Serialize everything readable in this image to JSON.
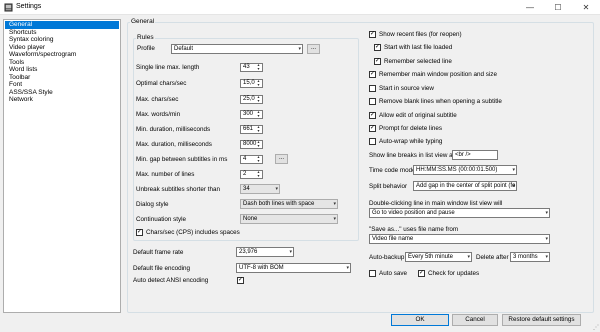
{
  "window": {
    "title": "Settings",
    "icon": "settings-app-icon",
    "minimize_glyph": "—",
    "maximize_glyph": "☐",
    "close_glyph": "✕"
  },
  "nav": {
    "items": [
      "General",
      "Shortcuts",
      "Syntax coloring",
      "Video player",
      "Waveform/spectrogram",
      "Tools",
      "Word lists",
      "Toolbar",
      "Font",
      "ASS/SSA Style",
      "Network"
    ],
    "selected": "General"
  },
  "general": {
    "group_title": "General",
    "rules": {
      "title": "Rules",
      "profile_label": "Profile",
      "profile_value": "Default",
      "profile_more": "...",
      "single_line_max_length_label": "Single line max. length",
      "single_line_max_length": "43",
      "optimal_chars_sec_label": "Optimal chars/sec",
      "optimal_chars_sec": "15,0",
      "max_chars_sec_label": "Max. chars/sec",
      "max_chars_sec": "25,0",
      "max_words_min_label": "Max. words/min",
      "max_words_min": "300",
      "min_duration_label": "Min. duration, milliseconds",
      "min_duration": "661",
      "max_duration_label": "Max. duration, milliseconds",
      "max_duration": "8000",
      "min_gap_label": "Min. gap between subtitles in ms",
      "min_gap": "4",
      "min_gap_more": "...",
      "max_lines_label": "Max. number of lines",
      "max_lines": "2",
      "unbreak_label": "Unbreak subtitles shorter than",
      "unbreak_value": "34",
      "dialog_style_label": "Dialog style",
      "dialog_style_value": "Dash both lines with space",
      "continuation_style_label": "Continuation style",
      "continuation_style_value": "None",
      "cps_spaces_label": "Chars/sec (CPS) includes spaces",
      "cps_spaces_checked": true
    },
    "default_frame_rate_label": "Default frame rate",
    "default_frame_rate": "23,976",
    "default_encoding_label": "Default file encoding",
    "default_encoding": "UTF-8 with BOM",
    "auto_detect_ansi_label": "Auto detect ANSI encoding",
    "auto_detect_ansi_checked": true,
    "right": {
      "show_recent_label": "Show recent files (for reopen)",
      "show_recent_checked": true,
      "start_last_file_label": "Start with last file loaded",
      "start_last_file_checked": true,
      "remember_selected_label": "Remember selected line",
      "remember_selected_checked": true,
      "remember_window_label": "Remember main window position and size",
      "remember_window_checked": true,
      "start_source_view_label": "Start in source view",
      "start_source_view_checked": false,
      "remove_blank_label": "Remove blank lines when opening a subtitle",
      "remove_blank_checked": false,
      "allow_edit_label": "Allow edit of original subtitle",
      "allow_edit_checked": true,
      "prompt_delete_label": "Prompt for delete lines",
      "prompt_delete_checked": true,
      "auto_wrap_label": "Auto-wrap while typing",
      "auto_wrap_checked": false,
      "line_breaks_label": "Show line breaks in list view as",
      "line_breaks_value": "<br />",
      "time_code_label": "Time code mode",
      "time_code_value": "HH:MM:SS.MS (00:00:01.500)",
      "split_behavior_label": "Split behavior",
      "split_behavior_value": "Add gap in the center of split point (fo",
      "dblclick_label": "Double-clicking line in main window list view will",
      "dblclick_value": "Go to video position and pause",
      "save_as_label": "\"Save as...\" uses file name from",
      "save_as_value": "Video file name",
      "auto_backup_label": "Auto-backup",
      "auto_backup_value": "Every 5th minute",
      "delete_after_label": "Delete after",
      "delete_after_value": "3 months",
      "auto_save_label": "Auto save",
      "auto_save_checked": false,
      "check_updates_label": "Check for updates",
      "check_updates_checked": true
    }
  },
  "footer": {
    "ok": "OK",
    "cancel": "Cancel",
    "restore": "Restore default settings"
  },
  "glyphs": {
    "check": "✓",
    "dropdown": "▾",
    "spin_up": "▲",
    "spin_down": "▼",
    "grip": "⋰"
  }
}
